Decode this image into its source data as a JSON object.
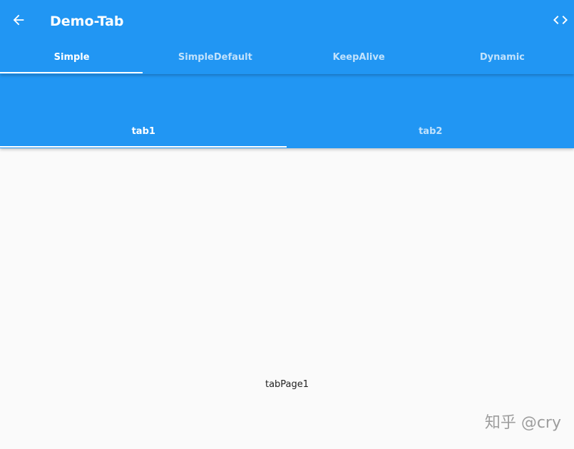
{
  "app_bar": {
    "title": "Demo-Tab",
    "back_icon": "arrow-back-icon",
    "code_icon": "code-icon",
    "background_color": "#2196f3"
  },
  "top_tabs": [
    {
      "label": "Simple",
      "selected": true
    },
    {
      "label": "SimpleDefault",
      "selected": false
    },
    {
      "label": "KeepAlive",
      "selected": false
    },
    {
      "label": "Dynamic",
      "selected": false
    }
  ],
  "inner_tabs": [
    {
      "label": "tab1",
      "selected": true
    },
    {
      "label": "tab2",
      "selected": false
    }
  ],
  "content": {
    "text": "tabPage1"
  },
  "watermark": {
    "text": "知乎 @cry"
  }
}
